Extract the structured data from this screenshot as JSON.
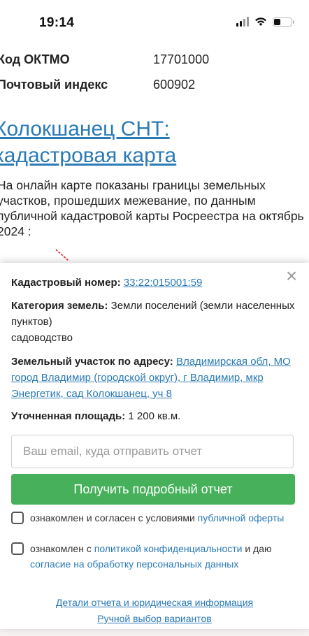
{
  "status_bar": {
    "time": "19:14"
  },
  "info": {
    "oktmo_label": "Код ОКТМО",
    "oktmo_value": "17701000",
    "postal_label": "Почтовый индекс",
    "postal_value": "600902"
  },
  "page": {
    "title_line1": "Колокшанец СНТ:",
    "title_line2": "кадастровая карта",
    "description": "На онлайн карте показаны границы земельных участков, прошедших межевание, по данным публичной кадастровой карты Росреестра на октябрь 2024 :"
  },
  "modal": {
    "close_glyph": "×",
    "cadastral_label": "Кадастровый номер:",
    "cadastral_value": "33:22:015001:59",
    "category_label": "Категория земель:",
    "category_value": "Земли поселений (земли населенных пунктов)",
    "category_sub": "садоводство",
    "address_label": "Земельный участок по адресу:",
    "address_value": "Владимирская обл, МО город Владимир (городской округ), г Владимир, мкр Энергетик, сад Колокшанец, уч 8",
    "area_label": "Уточненная площадь:",
    "area_value": "1 200 кв.м.",
    "email_placeholder": "Ваш email, куда отправить отчет",
    "submit_label": "Получить подробный отчет",
    "consent1_text": "ознакомлен и согласен с условиями ",
    "consent1_link": "публичной оферты",
    "consent2_text": "ознакомлен с ",
    "consent2_link1": "политикой конфиденциальности",
    "consent2_mid": " и даю ",
    "consent2_link2": "согласие на обработку персональных данных",
    "footer_link1": "Детали отчета и юридическая информация",
    "footer_link2": "Ручной выбор вариантов"
  }
}
